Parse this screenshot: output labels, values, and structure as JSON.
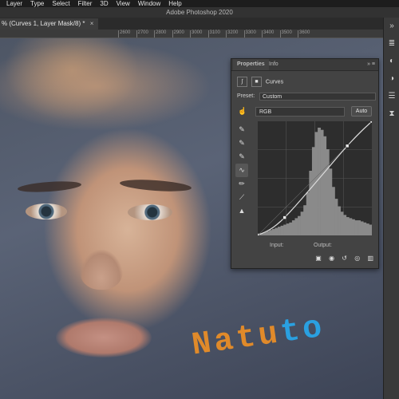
{
  "menubar": {
    "items": [
      "Layer",
      "Type",
      "Select",
      "Filter",
      "3D",
      "View",
      "Window",
      "Help"
    ]
  },
  "app_title": "Adobe Photoshop 2020",
  "document_tab": {
    "label": "% (Curves 1, Layer Mask/8) *",
    "close": "×"
  },
  "ruler": {
    "ticks": [
      "2600",
      "2700",
      "2800",
      "2900",
      "3000",
      "3100",
      "3200",
      "3300",
      "3400",
      "3500",
      "3600"
    ]
  },
  "properties_panel": {
    "tabs": [
      "Properties",
      "Info"
    ],
    "panel_controls": "»  ≡",
    "adjustment_name": "Curves",
    "preset_label": "Preset:",
    "preset_value": "Custom",
    "channel_value": "RGB",
    "auto_label": "Auto",
    "input_label": "Input:",
    "output_label": "Output:",
    "tools": [
      "on-image-adjust-icon",
      "black-eyedropper-icon",
      "gray-eyedropper-icon",
      "white-eyedropper-icon",
      "curve-points-icon",
      "pencil-icon",
      "smooth-icon",
      "clipping-warning-icon"
    ]
  },
  "curve": {
    "points": [
      [
        0,
        0
      ],
      [
        60,
        40
      ],
      [
        200,
        200
      ],
      [
        255,
        255
      ]
    ],
    "line_color": "#dcdcdc"
  },
  "histogram": {
    "bins": [
      2,
      2,
      3,
      4,
      5,
      6,
      7,
      8,
      9,
      10,
      11,
      12,
      14,
      16,
      18,
      22,
      28,
      40,
      60,
      82,
      96,
      100,
      98,
      92,
      80,
      62,
      45,
      34,
      27,
      22,
      19,
      17,
      16,
      15,
      14,
      14,
      13,
      12,
      11,
      10
    ],
    "fill_color": "#8a8a8a"
  },
  "watermark": {
    "part1": "Natu",
    "part2": "to",
    "color1": "#e08a2a",
    "color2": "#2aa0e0"
  },
  "right_toolbar": {
    "icons": [
      "panel-collapse-icon",
      "layers-icon",
      "channels-icon",
      "adjustments-icon",
      "properties-icon",
      "history-icon"
    ]
  }
}
